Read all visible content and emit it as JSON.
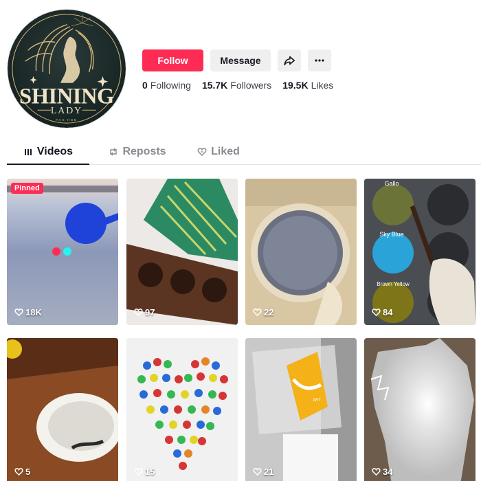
{
  "profile": {
    "logo_text_main": "SHINING",
    "logo_text_sub": "LADY",
    "logo_text_small": "FAS HDE"
  },
  "actions": {
    "follow_label": "Follow",
    "message_label": "Message",
    "share_icon": "share-arrow-icon",
    "more_icon": "more-dots-icon"
  },
  "stats": {
    "following_count": "0",
    "following_label": "Following",
    "followers_count": "15.7K",
    "followers_label": "Followers",
    "likes_count": "19.5K",
    "likes_label": "Likes"
  },
  "tabs": [
    {
      "label": "Videos",
      "icon": "grid-lines-icon",
      "active": true
    },
    {
      "label": "Reposts",
      "icon": "repost-icon",
      "active": false
    },
    {
      "label": "Liked",
      "icon": "liked-heart-icon",
      "active": false
    }
  ],
  "videos": [
    {
      "views": "18K",
      "pinned": "Pinned"
    },
    {
      "views": "97"
    },
    {
      "views": "22"
    },
    {
      "views": "84",
      "labels": [
        "Gallo",
        "Sky Blue",
        "Brown Yellow"
      ]
    },
    {
      "views": "5"
    },
    {
      "views": "15"
    },
    {
      "views": "21",
      "labels": [
        "ART"
      ]
    },
    {
      "views": "34"
    }
  ],
  "colors": {
    "accent": "#fe2c55",
    "button_gray": "#efefef",
    "text_primary": "#161823",
    "logo_gold": "#d9b77a",
    "logo_bg": "#1c2a2a"
  }
}
